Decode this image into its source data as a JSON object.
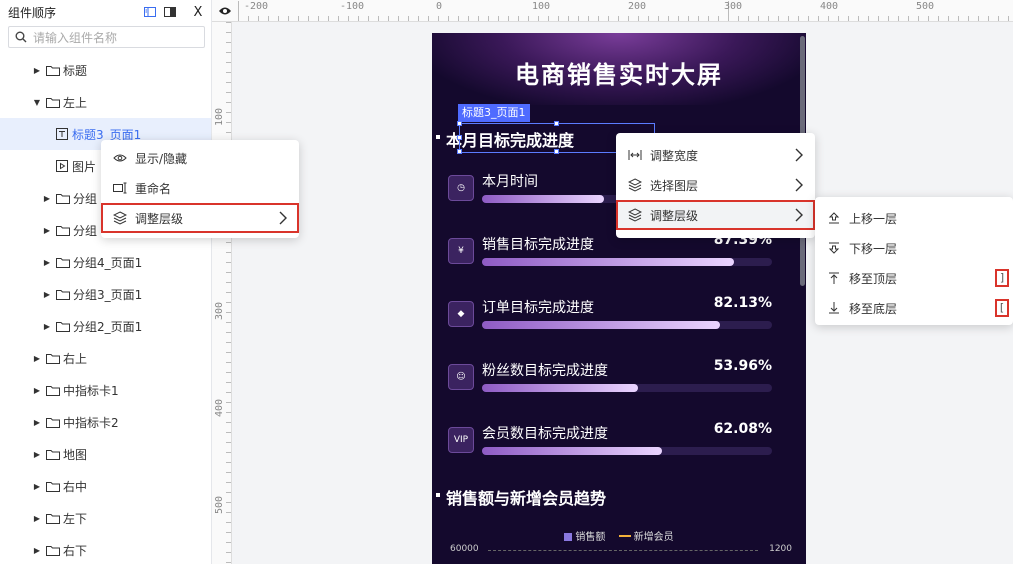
{
  "panel": {
    "title": "组件顺序",
    "search_placeholder": "请输入组件名称",
    "close_symbol": "X"
  },
  "tree": [
    {
      "label": "标题",
      "level": 1,
      "arrow": "▶",
      "kind": "folder"
    },
    {
      "label": "左上",
      "level": 1,
      "arrow": "▼",
      "kind": "folder"
    },
    {
      "label": "标题3_页面1",
      "level": 2,
      "arrow": "",
      "kind": "text",
      "selected": true
    },
    {
      "label": "图片",
      "level": 2,
      "arrow": "",
      "kind": "image"
    },
    {
      "label": "分组",
      "level": 2,
      "arrow": "▶",
      "kind": "folder"
    },
    {
      "label": "分组",
      "level": 2,
      "arrow": "▶",
      "kind": "folder"
    },
    {
      "label": "分组4_页面1",
      "level": 2,
      "arrow": "▶",
      "kind": "folder"
    },
    {
      "label": "分组3_页面1",
      "level": 2,
      "arrow": "▶",
      "kind": "folder"
    },
    {
      "label": "分组2_页面1",
      "level": 2,
      "arrow": "▶",
      "kind": "folder"
    },
    {
      "label": "右上",
      "level": 1,
      "arrow": "▶",
      "kind": "folder"
    },
    {
      "label": "中指标卡1",
      "level": 1,
      "arrow": "▶",
      "kind": "folder"
    },
    {
      "label": "中指标卡2",
      "level": 1,
      "arrow": "▶",
      "kind": "folder"
    },
    {
      "label": "地图",
      "level": 1,
      "arrow": "▶",
      "kind": "folder"
    },
    {
      "label": "右中",
      "level": 1,
      "arrow": "▶",
      "kind": "folder"
    },
    {
      "label": "左下",
      "level": 1,
      "arrow": "▶",
      "kind": "folder"
    },
    {
      "label": "右下",
      "level": 1,
      "arrow": "▶",
      "kind": "folder"
    }
  ],
  "ruler": {
    "top_labels": [
      "-200",
      "-100",
      "0",
      "100",
      "200",
      "300",
      "400",
      "500"
    ],
    "left_labels": [
      "100",
      "200",
      "300",
      "400",
      "500"
    ]
  },
  "screen": {
    "title": "电商销售实时大屏",
    "selection_tag": "标题3_页面1",
    "section1_title": "本月目标完成进度",
    "metrics": [
      {
        "label": "本月时间",
        "value": "",
        "progress": 0.42,
        "icon": "clock-icon"
      },
      {
        "label": "销售目标完成进度",
        "value": "87.39%",
        "progress": 0.87,
        "icon": "yen-icon"
      },
      {
        "label": "订单目标完成进度",
        "value": "82.13%",
        "progress": 0.8213,
        "icon": "tag-icon"
      },
      {
        "label": "粉丝数目标完成进度",
        "value": "53.96%",
        "progress": 0.5396,
        "icon": "fan-icon"
      },
      {
        "label": "会员数目标完成进度",
        "value": "62.08%",
        "progress": 0.6208,
        "icon": "vip-icon"
      }
    ],
    "vip_text": "VIP",
    "section2_title": "销售额与新增会员趋势",
    "legend": [
      "销售额",
      "新增会员"
    ],
    "axis_left": "60000",
    "axis_right": "1200"
  },
  "menu_left": [
    {
      "label": "显示/隐藏",
      "icon": "eye-icon"
    },
    {
      "label": "重命名",
      "icon": "rename-icon"
    },
    {
      "label": "调整层级",
      "icon": "layers-icon",
      "submenu": true,
      "highlight": true
    }
  ],
  "menu_mid": [
    {
      "label": "调整宽度",
      "icon": "width-icon",
      "submenu": true
    },
    {
      "label": "选择图层",
      "icon": "layers-icon",
      "submenu": true
    },
    {
      "label": "调整层级",
      "icon": "layers-icon",
      "submenu": true,
      "highlight": true,
      "active": true
    }
  ],
  "menu_right": [
    {
      "label": "上移一层",
      "icon": "move-up-icon",
      "shortcut": ""
    },
    {
      "label": "下移一层",
      "icon": "move-down-icon",
      "shortcut": ""
    },
    {
      "label": "移至顶层",
      "icon": "to-top-icon",
      "shortcut": "]"
    },
    {
      "label": "移至底层",
      "icon": "to-bottom-icon",
      "shortcut": "["
    }
  ],
  "colors": {
    "accent": "#4f6bff",
    "highlight": "#d9342b",
    "screen_bg": "#14092d"
  }
}
